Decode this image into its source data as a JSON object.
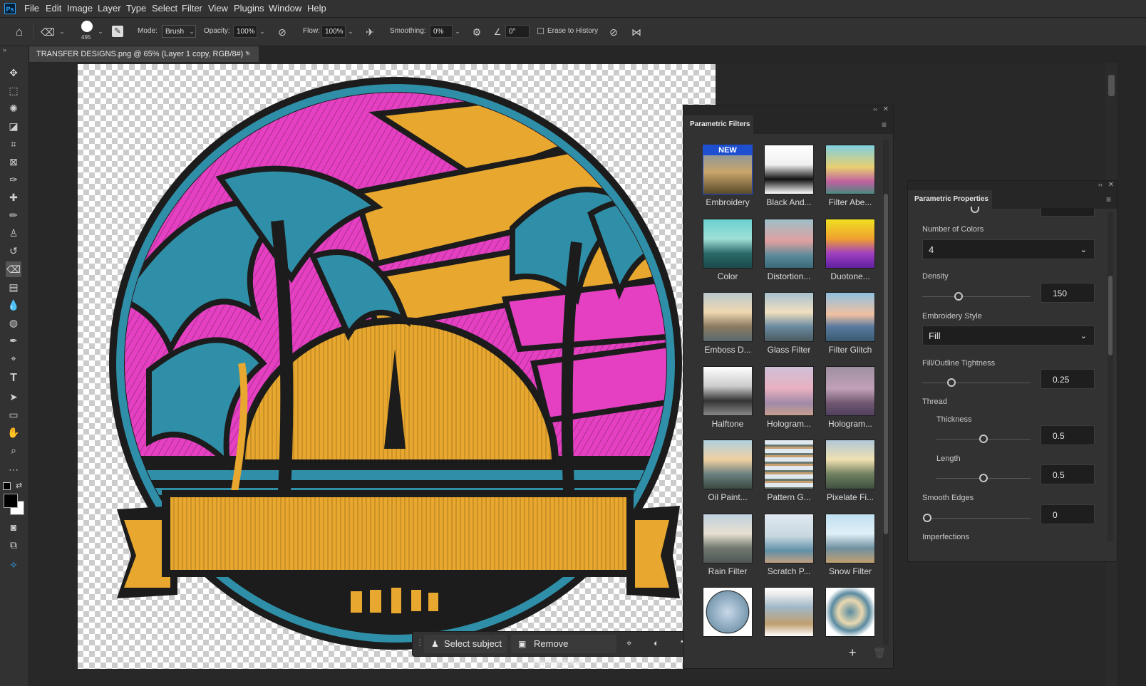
{
  "app": {
    "logo": "Ps"
  },
  "menu": [
    "File",
    "Edit",
    "Image",
    "Layer",
    "Type",
    "Select",
    "Filter",
    "View",
    "Plugins",
    "Window",
    "Help"
  ],
  "options": {
    "brush_size": "495",
    "mode_label": "Mode:",
    "mode_value": "Brush",
    "opacity_label": "Opacity:",
    "opacity_value": "100%",
    "flow_label": "Flow:",
    "flow_value": "100%",
    "smoothing_label": "Smoothing:",
    "smoothing_value": "0%",
    "angle_value": "0°",
    "erase_history_label": "Erase to History"
  },
  "document": {
    "tab_title": "TRANSFER DESIGNS.png @ 65% (Layer 1 copy, RGB/8#) *",
    "close": "×"
  },
  "parametric_filters": {
    "title": "Parametric Filters",
    "new_badge": "NEW",
    "items": [
      {
        "label": "Embroidery"
      },
      {
        "label": "Black And..."
      },
      {
        "label": "Filter Abe..."
      },
      {
        "label": "Color"
      },
      {
        "label": "Distortion..."
      },
      {
        "label": "Duotone..."
      },
      {
        "label": "Emboss D..."
      },
      {
        "label": "Glass Filter"
      },
      {
        "label": "Filter Glitch"
      },
      {
        "label": "Halftone"
      },
      {
        "label": "Hologram..."
      },
      {
        "label": "Hologram..."
      },
      {
        "label": "Oil Paint..."
      },
      {
        "label": "Pattern G..."
      },
      {
        "label": "Pixelate Fi..."
      },
      {
        "label": "Rain Filter"
      },
      {
        "label": "Scratch P..."
      },
      {
        "label": "Snow Filter"
      },
      {
        "label": ""
      },
      {
        "label": ""
      },
      {
        "label": ""
      }
    ],
    "add_icon": "+"
  },
  "parametric_properties": {
    "title": "Parametric Properties",
    "number_of_colors_label": "Number of Colors",
    "number_of_colors_value": "4",
    "density_label": "Density",
    "density_value": "150",
    "density_level": 0.25,
    "embroidery_style_label": "Embroidery Style",
    "embroidery_style_value": "Fill",
    "tightness_label": "Fill/Outline Tightness",
    "tightness_value": "0.25",
    "thread_label": "Thread",
    "thickness_label": "Thickness",
    "thickness_value": "0.5",
    "length_label": "Length",
    "length_value": "0.5",
    "smooth_edges_label": "Smooth Edges",
    "smooth_edges_value": "0",
    "imperfections_label": "Imperfections"
  },
  "context_bar": {
    "select_subject": "Select subject",
    "remove_background": "Remove background",
    "more": "•••"
  },
  "colors": {
    "pink": "#e540c2",
    "teal": "#2f8fa8",
    "gold": "#e8a72e",
    "stitch": "#1c1c1c",
    "accent": "#31a8ff"
  }
}
